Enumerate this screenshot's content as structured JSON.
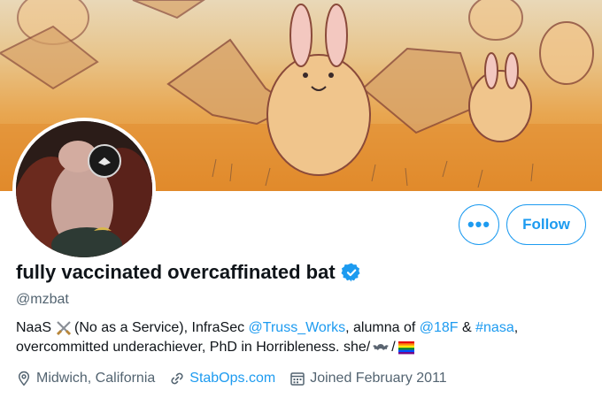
{
  "profile": {
    "display_name": "fully vaccinated overcaffinated bat",
    "handle": "@mzbat",
    "verified": true
  },
  "actions": {
    "more_label": "•••",
    "follow_label": "Follow"
  },
  "bio": {
    "line1_part1": "NaaS",
    "line1_part2": "(No as a Service), InfraSec ",
    "line1_mention1": "@Truss_Works",
    "line1_part3": ", alumna of ",
    "line1_mention2": "@18F",
    "line1_part4": " & ",
    "line1_hashtag": "#nasa",
    "line1_part5": ",",
    "line2_text": "overcommitted underachiever, PhD in Horribleness. she/",
    "line2_slash": "/"
  },
  "meta": {
    "location": "Midwich, California",
    "website": "StabOps.com",
    "joined": "Joined February 2011"
  },
  "colors": {
    "accent": "#1d9bf0",
    "muted": "#536471",
    "text": "#0f1419"
  },
  "icons": {
    "location": "location-pin-icon",
    "link": "link-icon",
    "calendar": "calendar-icon",
    "verified": "verified-badge-icon"
  }
}
